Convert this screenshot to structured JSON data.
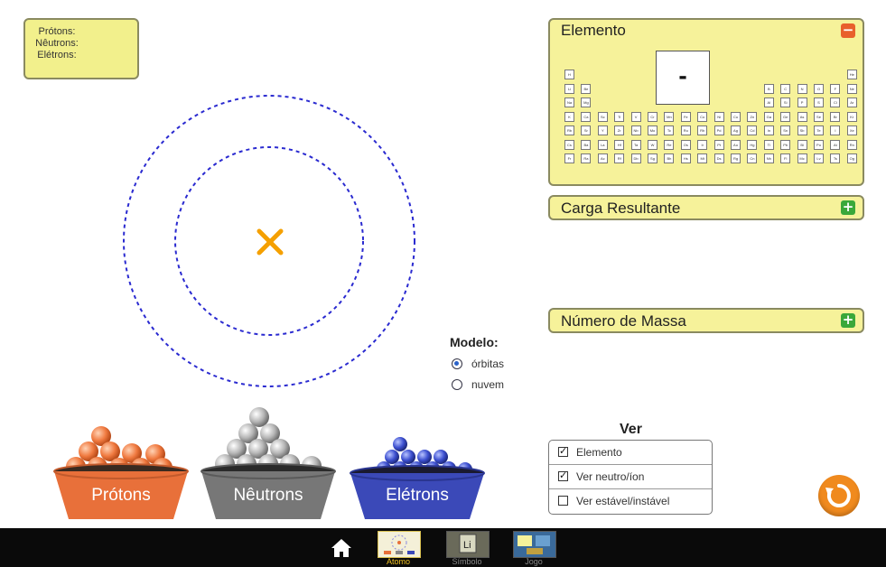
{
  "counts": {
    "protons_label": "Prótons:",
    "neutrons_label": "Nêutrons:",
    "electrons_label": "Elétrons:"
  },
  "nucleus": {
    "icon": "x-marker-icon",
    "color": "#f5a000"
  },
  "element_panel": {
    "title": "Elemento",
    "symbol": "-",
    "toggle": "−"
  },
  "periodic_table": {
    "rows": [
      [
        "H",
        "",
        "",
        "",
        "",
        "",
        "",
        "",
        "",
        "",
        "",
        "",
        "",
        "",
        "",
        "",
        "",
        "He"
      ],
      [
        "Li",
        "Be",
        "",
        "",
        "",
        "",
        "",
        "",
        "",
        "",
        "",
        "",
        "B",
        "C",
        "N",
        "O",
        "F",
        "Ne"
      ],
      [
        "Na",
        "Mg",
        "",
        "",
        "",
        "",
        "",
        "",
        "",
        "",
        "",
        "",
        "Al",
        "Si",
        "P",
        "S",
        "Cl",
        "Ar"
      ],
      [
        "K",
        "Ca",
        "Sc",
        "Ti",
        "V",
        "Cr",
        "Mn",
        "Fe",
        "Co",
        "Ni",
        "Cu",
        "Zn",
        "Ga",
        "Ge",
        "As",
        "Se",
        "Br",
        "Kr"
      ],
      [
        "Rb",
        "Sr",
        "Y",
        "Zr",
        "Nb",
        "Mo",
        "Tc",
        "Ru",
        "Rh",
        "Pd",
        "Ag",
        "Cd",
        "In",
        "Sn",
        "Sb",
        "Te",
        "I",
        "Xe"
      ],
      [
        "Cs",
        "Ba",
        "La",
        "Hf",
        "Ta",
        "W",
        "Re",
        "Os",
        "Ir",
        "Pt",
        "Au",
        "Hg",
        "Tl",
        "Pb",
        "Bi",
        "Po",
        "At",
        "Rn"
      ],
      [
        "Fr",
        "Ra",
        "Ac",
        "Rf",
        "Db",
        "Sg",
        "Bh",
        "Hs",
        "Mt",
        "Ds",
        "Rg",
        "Cn",
        "Nh",
        "Fl",
        "Mc",
        "Lv",
        "Ts",
        "Og"
      ]
    ]
  },
  "charge_panel": {
    "title": "Carga Resultante",
    "toggle": "+"
  },
  "mass_panel": {
    "title": "Número de Massa",
    "toggle": "+"
  },
  "model": {
    "title": "Modelo:",
    "options": [
      {
        "label": "órbitas",
        "selected": true
      },
      {
        "label": "nuvem",
        "selected": false
      }
    ]
  },
  "ver": {
    "title": "Ver",
    "options": [
      {
        "label": "Elemento",
        "checked": true
      },
      {
        "label": "Ver neutro/íon",
        "checked": true
      },
      {
        "label": "Ver estável/instável",
        "checked": false
      }
    ]
  },
  "buckets": {
    "protons": "Prótons",
    "neutrons": "Nêutrons",
    "electrons": "Elétrons"
  },
  "colors": {
    "protons": "#e8703a",
    "neutrons": "#888888",
    "electrons": "#3b49b8",
    "panel": "#f6f29a",
    "orbit": "#2a2ad0"
  },
  "bottom_bar": {
    "home_icon": "home-icon",
    "tabs": [
      {
        "label": "Átomo",
        "active": true
      },
      {
        "label": "Símbolo",
        "active": false
      },
      {
        "label": "Jogo",
        "active": false
      }
    ]
  }
}
